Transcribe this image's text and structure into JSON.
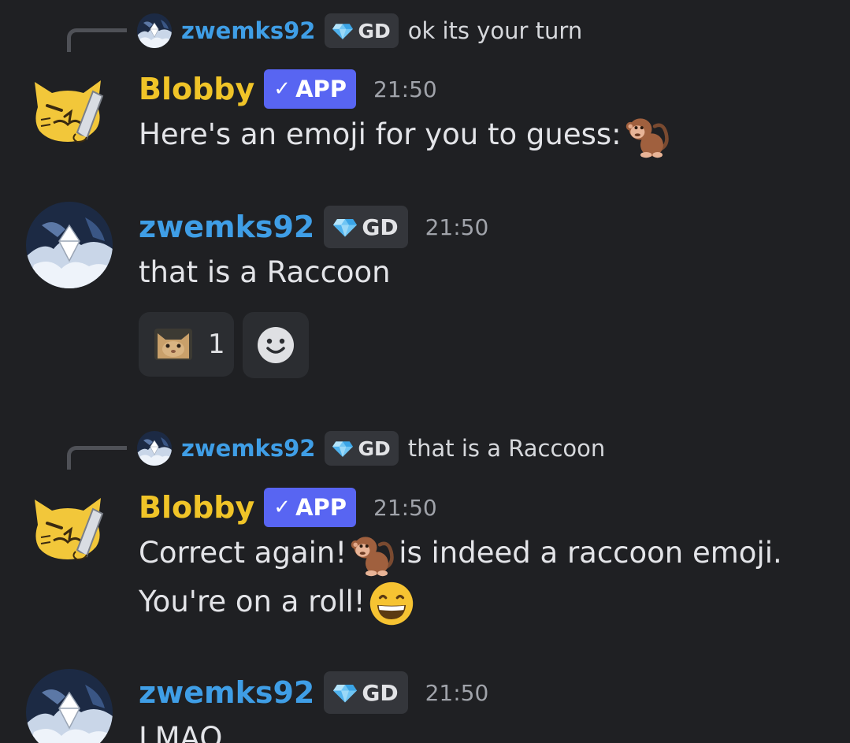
{
  "messages": [
    {
      "reply": {
        "author": "zwemks92",
        "tag": "GD",
        "text": "ok its your turn"
      },
      "author": "Blobby",
      "badge": "APP",
      "time": "21:50",
      "text_before": "Here's an emoji for you to guess:",
      "emoji": "monkey-emoji"
    },
    {
      "author": "zwemks92",
      "tag": "GD",
      "time": "21:50",
      "text": "that is a Raccoon",
      "reactions": [
        {
          "emoji": "cat-face-emoji",
          "count": "1"
        }
      ]
    },
    {
      "reply": {
        "author": "zwemks92",
        "tag": "GD",
        "text": "that is a Raccoon"
      },
      "author": "Blobby",
      "badge": "APP",
      "time": "21:50",
      "line1_before": "Correct again!",
      "line1_after": "is indeed a raccoon emoji.",
      "line2": "You're on a roll!",
      "emojis": [
        "monkey-emoji",
        "grinning-face-emoji"
      ]
    },
    {
      "author": "zwemks92",
      "tag": "GD",
      "time": "21:50",
      "text": "LMAO"
    }
  ],
  "colors": {
    "background": "#1f2023",
    "bot_name": "#f0c428",
    "user_name": "#3f9ee6",
    "app_badge": "#5865f2"
  }
}
